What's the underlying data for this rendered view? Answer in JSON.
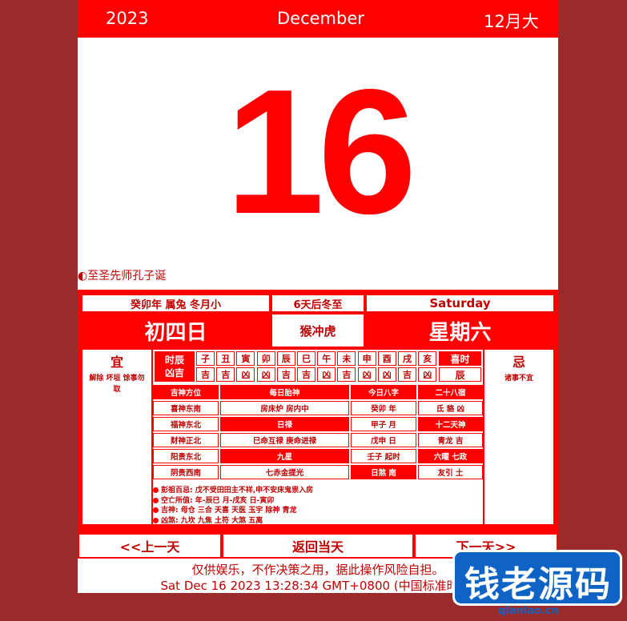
{
  "header": {
    "year": "2023",
    "month_en": "December",
    "month_cn": "12月大"
  },
  "day": "16",
  "festival": "◐至圣先师孔子诞",
  "info": {
    "year_gz": "癸卯年 属兔 冬月小",
    "solar_term": "6天后冬至",
    "weekday_en": "Saturday",
    "lunar_day": "初四日",
    "clash": "猴冲虎",
    "weekday_cn": "星期六"
  },
  "yi": {
    "title": "宜",
    "desc": "解除 坏垣 馀事勿取"
  },
  "ji": {
    "title": "忌",
    "desc": "诸事不宜"
  },
  "hours": {
    "label1": "时辰",
    "label2": "凶吉",
    "branches": [
      "子",
      "丑",
      "寅",
      "卯",
      "辰",
      "巳",
      "午",
      "未",
      "申",
      "酉",
      "戌",
      "亥"
    ],
    "luck": [
      "吉",
      "吉",
      "凶",
      "凶",
      "吉",
      "吉",
      "凶",
      "吉",
      "凶",
      "凶",
      "吉",
      "凶"
    ],
    "xishi_label": "喜时",
    "xishi_value": "辰"
  },
  "grid": {
    "h1": "吉神方位",
    "h2": "每日胎神",
    "h3": "今日八字",
    "h4": "二十八宿",
    "c1": [
      "喜神东南",
      "福神东北",
      "财神正北",
      "阳贵东北",
      "阴贵西南"
    ],
    "c2": [
      "房床炉 房内中",
      "日禄",
      "巳命互禄 庚命进禄",
      "九星",
      "七赤金提光"
    ],
    "c3": [
      "癸卯 年",
      "甲子 月",
      "戊申 日",
      "壬子 起时",
      "日煞 南"
    ],
    "c4": [
      "氐 貉 凶",
      "十二天神",
      "青龙 吉",
      "六曜 七政",
      "友引 土"
    ]
  },
  "notes": [
    "彭祖百忌: 戊不受田田主不祥,申不安床鬼祟入房",
    "空亡所值: 年-辰巳 月-戌亥 日-寅卯",
    "吉神: 母仓 三合 天喜 天医 玉宇 除神 青龙",
    "凶煞: 九坎 九焦 土符 大煞 五离"
  ],
  "nav": {
    "prev": "<<上一天",
    "today": "返回当天",
    "next": "下一天>>"
  },
  "footer": {
    "disclaimer": "仅供娱乐，不作决策之用，据此操作风险自担。",
    "timestamp": "Sat Dec 16 2023 13:28:34 GMT+0800 (中国标准时间)"
  },
  "watermark": {
    "text": "钱老源码",
    "url": "qianlao.cn"
  }
}
